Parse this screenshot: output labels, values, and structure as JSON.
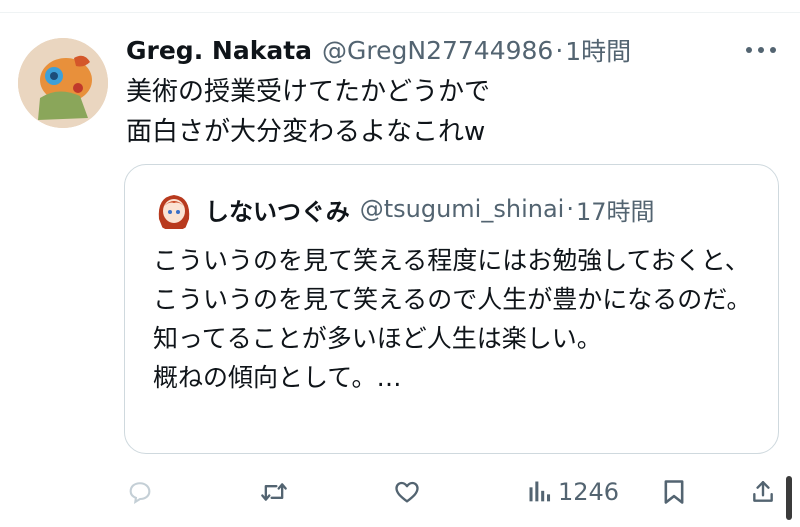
{
  "tweet": {
    "author_name": "Greg. Nakata",
    "handle": "@GregN27744986",
    "separator": "·",
    "time": "1時間",
    "text": "美術の授業受けてたかどうかで\n面白さが大分変わるよなこれw",
    "more_icon": "more-horizontal-icon"
  },
  "quoted_tweet": {
    "author_name": "しないつぐみ",
    "handle": "@tsugumi_shinai",
    "separator": "·",
    "time": "17時間",
    "text": "こういうのを見て笑える程度にはお勉強しておくと、こういうのを見て笑えるので人生が豊かになるのだ。\n知ってることが多いほど人生は楽しい。\n概ねの傾向として。…"
  },
  "actions": {
    "reply_icon": "reply-icon",
    "retweet_icon": "retweet-icon",
    "like_icon": "heart-icon",
    "views_icon": "views-icon",
    "views_count": "1246",
    "bookmark_icon": "bookmark-icon",
    "share_icon": "share-icon"
  },
  "colors": {
    "text": "#0f1419",
    "secondary": "#536471",
    "border": "#cfd9de"
  }
}
